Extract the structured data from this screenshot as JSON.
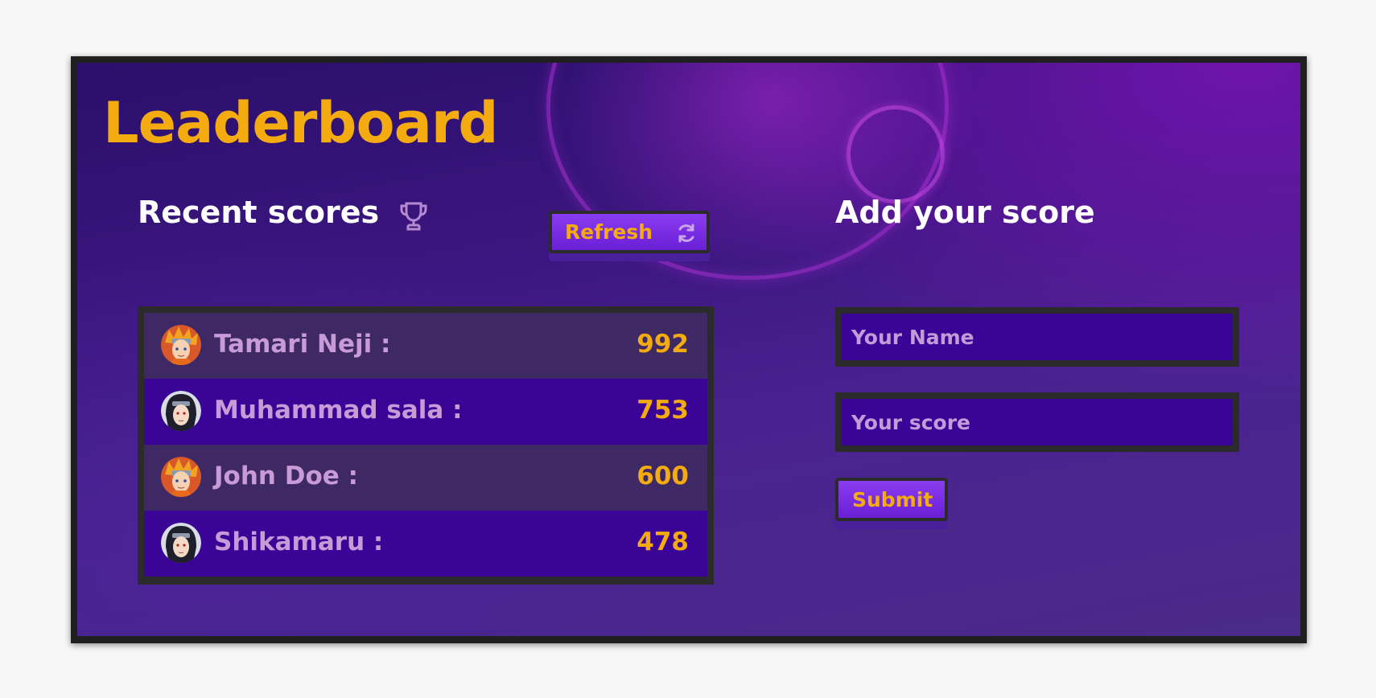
{
  "app": {
    "title": "Leaderboard"
  },
  "recent": {
    "heading": "Recent scores",
    "heading_icon": "trophy-icon",
    "refresh_label": "Refresh",
    "refresh_icon": "refresh-icon",
    "entries": [
      {
        "name": "Tamari Neji :",
        "score": "992",
        "avatar": "orange-hair-ninja-avatar"
      },
      {
        "name": "Muhammad sala :",
        "score": "753",
        "avatar": "dark-hair-ninja-avatar"
      },
      {
        "name": "John Doe :",
        "score": "600",
        "avatar": "orange-hair-ninja-avatar"
      },
      {
        "name": "Shikamaru :",
        "score": "478",
        "avatar": "dark-hair-ninja-avatar"
      }
    ]
  },
  "add": {
    "heading": "Add your score",
    "name_placeholder": "Your Name",
    "name_value": "",
    "score_placeholder": "Your score",
    "score_value": "",
    "submit_label": "Submit"
  },
  "colors": {
    "accent": "#f4ab0f",
    "background": "#3c1680",
    "row_dark": "#3a0496",
    "button": "#7a2ee6",
    "border": "#2b2b2b",
    "name_text": "#c89ad6"
  }
}
